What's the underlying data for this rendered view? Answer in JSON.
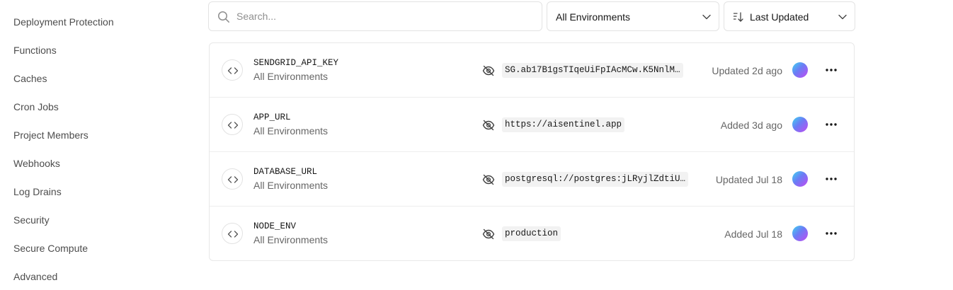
{
  "sidebar": {
    "items": [
      {
        "label": "Deployment Protection"
      },
      {
        "label": "Functions"
      },
      {
        "label": "Caches"
      },
      {
        "label": "Cron Jobs"
      },
      {
        "label": "Project Members"
      },
      {
        "label": "Webhooks"
      },
      {
        "label": "Log Drains"
      },
      {
        "label": "Security"
      },
      {
        "label": "Secure Compute"
      },
      {
        "label": "Advanced"
      }
    ]
  },
  "toolbar": {
    "search_placeholder": "Search...",
    "environment_filter": "All Environments",
    "sort": "Last Updated"
  },
  "env_vars": [
    {
      "name": "SENDGRID_API_KEY",
      "environment": "All Environments",
      "value": "SG.ab17B1gsTIqeUiFpIAcMCw.K5NnlM…",
      "updated": "Updated 2d ago"
    },
    {
      "name": "APP_URL",
      "environment": "All Environments",
      "value": "https://aisentinel.app",
      "updated": "Added 3d ago"
    },
    {
      "name": "DATABASE_URL",
      "environment": "All Environments",
      "value": "postgresql://postgres:jLRyjlZdtiU…",
      "updated": "Updated Jul 18"
    },
    {
      "name": "NODE_ENV",
      "environment": "All Environments",
      "value": "production",
      "updated": "Added Jul 18"
    }
  ],
  "colors": {
    "text": "#171717",
    "muted": "#666666",
    "border": "#e8e8e8",
    "value_bg": "#f2f2f2"
  },
  "icons": {
    "search": "search-icon",
    "chevron": "chevron-down-icon",
    "sort": "sort-icon",
    "code": "code-icon",
    "hidden": "eye-off-icon",
    "more": "more-horizontal-icon"
  }
}
